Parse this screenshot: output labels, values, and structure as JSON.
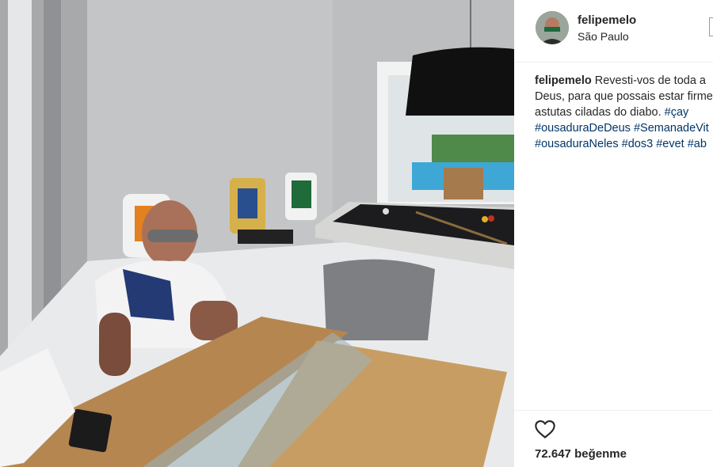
{
  "post": {
    "username": "felipemelo",
    "location": "São Paulo",
    "caption": {
      "user": "felipemelo",
      "line1_text": "Revesti-vos de toda a",
      "line2_text": "Deus, para que possais estar firme",
      "line3_text": "astutas ciladas do diabo.",
      "line3_tag": "#çay",
      "line4_tags": [
        "#ousaduraDeDeus",
        "#SemanadeVit"
      ],
      "line5_tags": [
        "#ousaduraNeles",
        "#dos3",
        "#evet",
        "#ab"
      ]
    },
    "likes_count": "72.647",
    "likes_word": "beğenme"
  },
  "icons": {
    "more": "more-options-icon",
    "like": "heart-icon"
  },
  "colors": {
    "hashtag": "#003569",
    "text": "#262626",
    "divider": "#efefef"
  }
}
